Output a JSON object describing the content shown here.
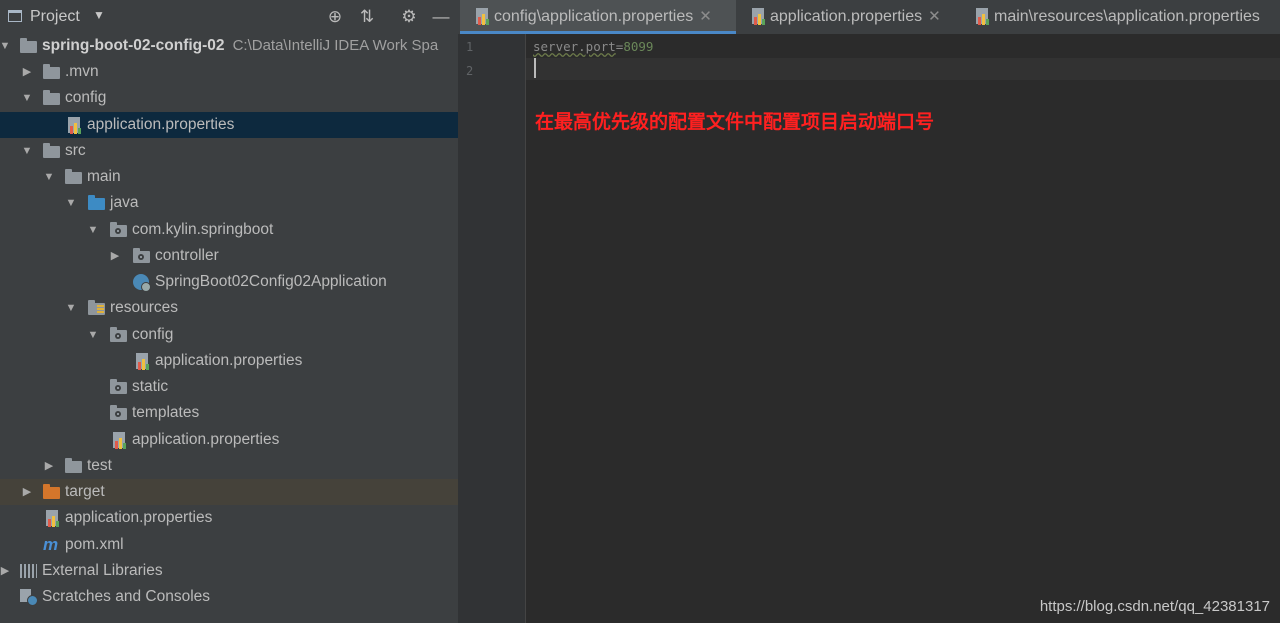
{
  "project": {
    "title": "Project",
    "dropdown": "▼",
    "buttons": {
      "locate": "⊕",
      "collapse": "⇅",
      "settings": "⚙",
      "hide": "—"
    }
  },
  "tree": [
    {
      "label": "spring-boot-02-config-02",
      "hint": "C:\\Data\\IntelliJ IDEA Work Spa",
      "expanded": true
    },
    {
      "label": ".mvn",
      "expanded": false
    },
    {
      "label": "config",
      "expanded": true
    },
    {
      "label": "application.properties"
    },
    {
      "label": "src",
      "expanded": true
    },
    {
      "label": "main",
      "expanded": true
    },
    {
      "label": "java",
      "expanded": true
    },
    {
      "label": "com.kylin.springboot",
      "expanded": true
    },
    {
      "label": "controller",
      "expanded": false
    },
    {
      "label": "SpringBoot02Config02Application"
    },
    {
      "label": "resources",
      "expanded": true
    },
    {
      "label": "config",
      "expanded": true
    },
    {
      "label": "application.properties"
    },
    {
      "label": "static"
    },
    {
      "label": "templates"
    },
    {
      "label": "application.properties"
    },
    {
      "label": "test",
      "expanded": false
    },
    {
      "label": "target",
      "expanded": false
    },
    {
      "label": "application.properties"
    },
    {
      "label": "pom.xml"
    },
    {
      "label": "External Libraries",
      "expanded": false
    },
    {
      "label": "Scratches and Consoles"
    }
  ],
  "tabs": [
    {
      "label": "config\\application.properties",
      "close": "✕",
      "active": true
    },
    {
      "label": "application.properties",
      "close": "✕",
      "active": false
    },
    {
      "label": "main\\resources\\application.properties",
      "close": "",
      "active": false
    }
  ],
  "editor": {
    "line_numbers": [
      "1",
      "2"
    ],
    "code_key": "server.port",
    "code_eq": "=",
    "code_val": "8099",
    "annotation": "在最高优先级的配置文件中配置项目启动端口号"
  },
  "watermark": "https://blog.csdn.net/qq_42381317",
  "colors": {
    "panel_bg": "#3c3f41",
    "editor_bg": "#2b2b2b",
    "selection": "#0d293e",
    "annotation": "#ff2020",
    "tab_underline": "#4a88c7"
  }
}
